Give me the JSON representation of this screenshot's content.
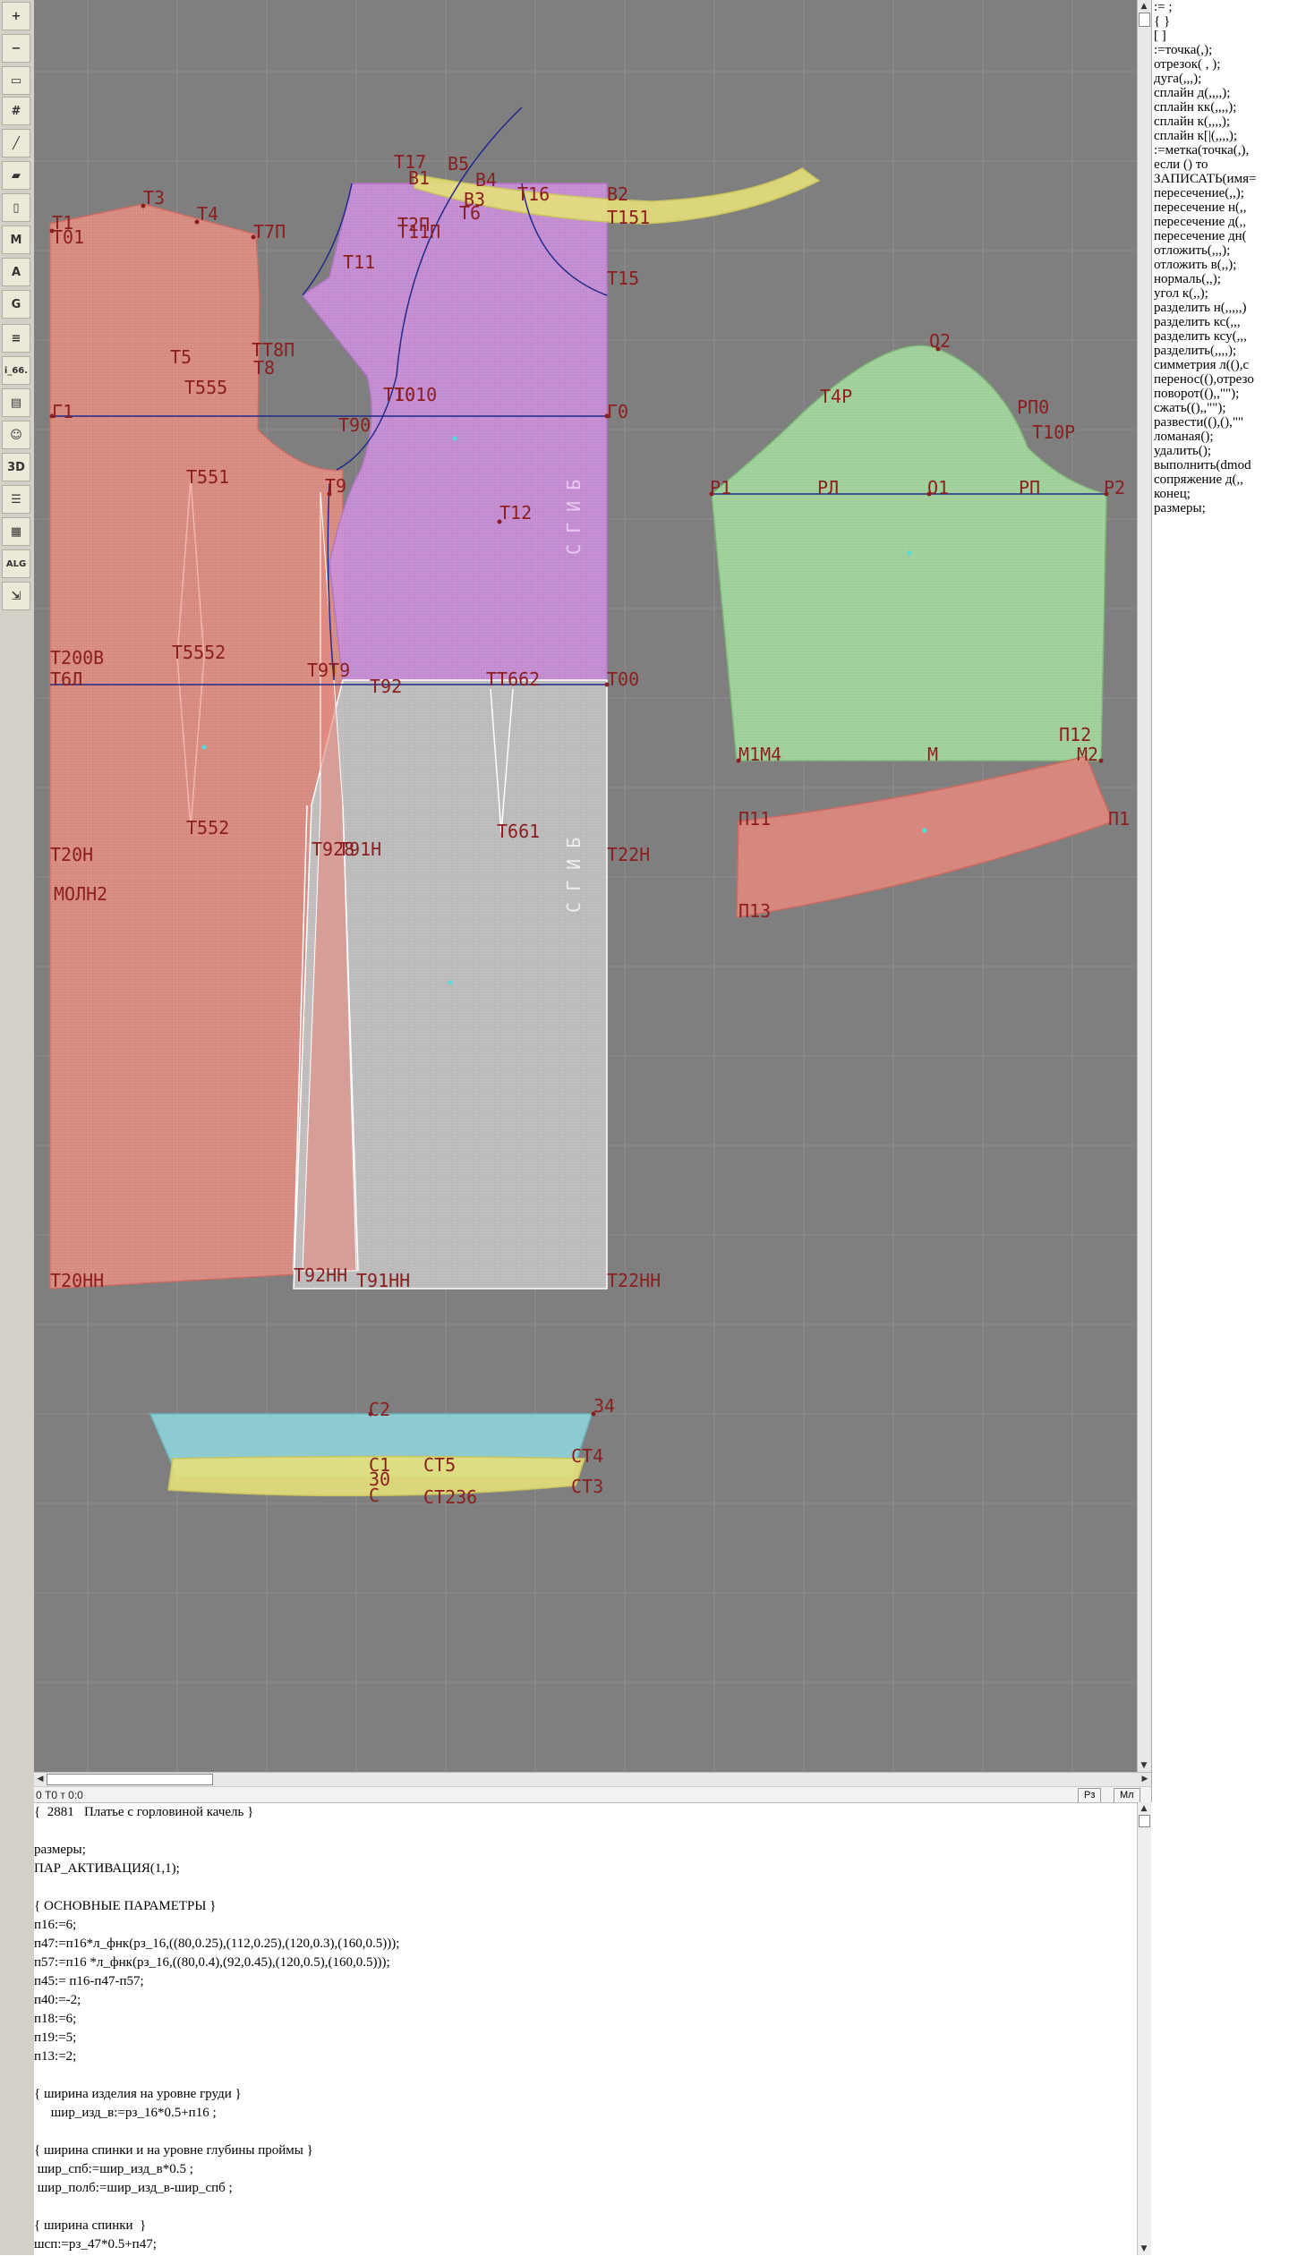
{
  "toolbar": {
    "tools": [
      {
        "name": "zoom-in-icon",
        "glyph": "+"
      },
      {
        "name": "zoom-out-icon",
        "glyph": "−"
      },
      {
        "name": "pattern-piece-icon",
        "glyph": "▭"
      },
      {
        "name": "grid-icon",
        "glyph": "#"
      },
      {
        "name": "line-tool-icon",
        "glyph": "╱"
      },
      {
        "name": "book-icon",
        "glyph": "▰"
      },
      {
        "name": "notebook-icon",
        "glyph": "▯"
      },
      {
        "name": "m-tool-icon",
        "glyph": "M"
      },
      {
        "name": "text-tool-icon",
        "glyph": "A"
      },
      {
        "name": "g-tool-icon",
        "glyph": "G"
      },
      {
        "name": "measure-icon",
        "glyph": "≡"
      },
      {
        "name": "i66-tool-icon",
        "glyph": "i_66."
      },
      {
        "name": "page-icon",
        "glyph": "▤"
      },
      {
        "name": "avatar-icon",
        "glyph": "☺"
      },
      {
        "name": "3d-tool-icon",
        "glyph": "3D"
      },
      {
        "name": "list-tool-icon",
        "glyph": "☰"
      },
      {
        "name": "layers-icon",
        "glyph": "▦"
      },
      {
        "name": "alg-tool-icon",
        "glyph": "ALG"
      },
      {
        "name": "export-icon",
        "glyph": "⇲"
      }
    ]
  },
  "labels": {
    "back": [
      "Т1",
      "Т01",
      "Т3",
      "Т4",
      "Т7П",
      "Т5",
      "ТТ8П",
      "Т8",
      "Т555",
      "Г1",
      "Т551",
      "Т9",
      "Т90",
      "Т200В",
      "Т6Л",
      "Т5552",
      "Т552",
      "Т20Н",
      "МОЛН2",
      "Т20НН",
      "Т92НН",
      "Т928",
      "Т91Н",
      "Т91НН"
    ],
    "front": [
      "Т17",
      "В5",
      "В4",
      "В3",
      "В2",
      "Т16",
      "В1",
      "Т6",
      "Т151",
      "Т2П",
      "Т11П",
      "Т11",
      "Т15",
      "Т10",
      "Т010",
      "Г0",
      "Т12",
      "Т9Т9",
      "Т92",
      "ТТ662",
      "Т00",
      "Т661",
      "Т22Н",
      "Т22НН",
      "С Г И Б",
      "С Г И Б"
    ],
    "sleeve": [
      "О2",
      "Т4Р",
      "РП0",
      "Т10Р",
      "Р1",
      "РЛ",
      "О1",
      "РП",
      "Р2",
      "М1",
      "М4",
      "М",
      "П12",
      "М2",
      "П11",
      "П13",
      "П1"
    ],
    "waistband": [
      "С2",
      "34",
      "С1",
      "СТ5",
      "СТ4",
      "30",
      "С",
      "СТ236",
      "СТ3"
    ]
  },
  "command_list": [
    ":= ;",
    "{ }",
    "[ ]",
    ":=точка(,);",
    "отрезок( , );",
    "дуга(,,,);",
    "сплайн д(,,,,);",
    "сплайн кк(,,,,);",
    "сплайн к(,,,,);",
    "сплайн к[|(,,,,);",
    ":=метка(точка(,),",
    "если () то",
    "ЗАПИСАТЬ(имя=",
    "пересечение(,,);",
    "пересечение н(,,",
    "пересечение д(,,",
    "пересечение дн(",
    "отложить(,,,);",
    "отложить в(,,);",
    "нормаль(,,);",
    "угол к(,,);",
    "разделить н(,,,,,)",
    "разделить кс(,,,",
    "разделить ксу(,,,",
    "разделить(,,,,);",
    "симметрия л((),с",
    "перенос((),отрезо",
    "поворот((),,\"\");",
    "сжать((),,\"\");",
    "развести((),(),\"\"",
    "ломаная();",
    "удалить();",
    "выполнить(dmod",
    "сопряжение д(,,",
    "конец;",
    "размеры;"
  ],
  "status": {
    "text": "0  Т0 т 0:0",
    "btn_rz": "Рз",
    "btn_ml": "Мл"
  },
  "editor_lines": [
    "{  2881   Платье с горловиной качель }",
    "",
    "размеры;",
    "ПАР_АКТИВАЦИЯ(1,1);",
    "",
    "{ ОСНОВНЫЕ ПАРАМЕТРЫ }",
    "п16:=6;",
    "п47:=п16*л_фнк(рз_16,((80,0.25),(112,0.25),(120,0.3),(160,0.5)));",
    "п57:=п16 *л_фнк(рз_16,((80,0.4),(92,0.45),(120,0.5),(160,0.5)));",
    "п45:= п16-п47-п57;",
    "п40:=-2;",
    "п18:=6;",
    "п19:=5;",
    "п13:=2;",
    "",
    "{ ширина изделия на уровне груди }",
    "     шир_изд_в:=рз_16*0.5+п16 ;",
    "",
    "{ ширина спинки и на уровне глубины проймы }",
    " шир_спб:=шир_изд_в*0.5 ;",
    " шир_полб:=шир_изд_в-шир_спб ;",
    "",
    "{ ширина спинки  }",
    "шсп:=рз_47*0.5+п47;"
  ],
  "colors": {
    "canvas_bg": "#7f7f7f",
    "back_piece": "#e58a7e",
    "front_piece": "#c98bd8",
    "sleeve": "#9fd39a",
    "skirt_front": "#bdbdbd",
    "yoke": "#e6e07a",
    "waistband_top": "#8fd0d6",
    "construction_line": "#1f2a8c",
    "point_label": "#8b1e1e"
  }
}
